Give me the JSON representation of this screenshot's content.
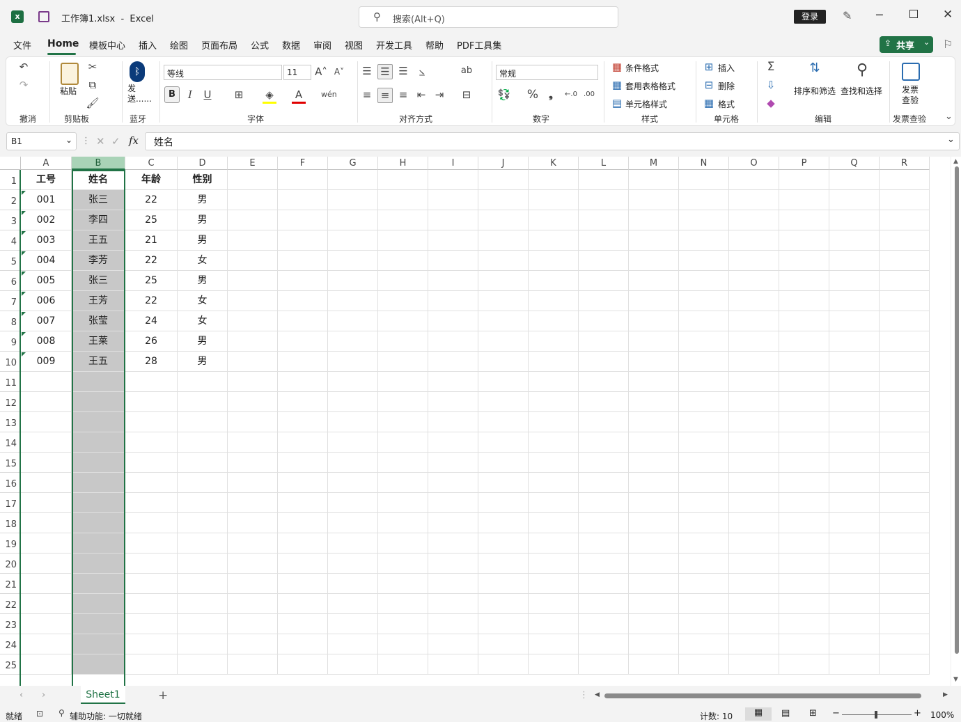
{
  "window": {
    "title": "工作簿1.xlsx  -  Excel",
    "login_label": "登录"
  },
  "search": {
    "placeholder": "搜索(Alt+Q)"
  },
  "menu": {
    "items": [
      "文件",
      "Home",
      "模板中心",
      "插入",
      "绘图",
      "页面布局",
      "公式",
      "数据",
      "审阅",
      "视图",
      "开发工具",
      "帮助",
      "PDF工具集"
    ],
    "active": "Home",
    "share_label": "共享"
  },
  "ribbon": {
    "groups": {
      "undo": "撤消",
      "clipboard": "剪贴板",
      "bluetooth": "蓝牙",
      "font": "字体",
      "align": "对齐方式",
      "number": "数字",
      "styles": "样式",
      "cells": "单元格",
      "edit": "编辑",
      "invoice": "发票查验"
    },
    "paste_label": "粘贴",
    "send_label": "发送......",
    "font_name": "等线",
    "font_size": "11",
    "number_format": "常规",
    "conditional_format": "条件格式",
    "table_format": "套用表格格式",
    "cell_style": "单元格样式",
    "insert": "插入",
    "delete": "删除",
    "format": "格式",
    "sort_filter": "排序和筛选",
    "find_select": "查找和选择",
    "invoice_check": "发票查验",
    "accent": "#217346"
  },
  "formula_bar": {
    "name_box": "B1",
    "fx": "fx",
    "content": "姓名"
  },
  "sheet": {
    "columns": [
      "A",
      "B",
      "C",
      "D",
      "E",
      "F",
      "G",
      "H",
      "I",
      "J",
      "K",
      "L",
      "M",
      "N",
      "O",
      "P",
      "Q",
      "R"
    ],
    "selected_column": "B",
    "rows": [
      [
        "工号",
        "姓名",
        "年龄",
        "性别"
      ],
      [
        "001",
        "张三",
        "22",
        "男"
      ],
      [
        "002",
        "李四",
        "25",
        "男"
      ],
      [
        "003",
        "王五",
        "21",
        "男"
      ],
      [
        "004",
        "李芳",
        "22",
        "女"
      ],
      [
        "005",
        "张三",
        "25",
        "男"
      ],
      [
        "006",
        "王芳",
        "22",
        "女"
      ],
      [
        "007",
        "张莹",
        "24",
        "女"
      ],
      [
        "008",
        "王莱",
        "26",
        "男"
      ],
      [
        "009",
        "王五",
        "28",
        "男"
      ]
    ],
    "row_numbers": [
      "1",
      "2",
      "3",
      "4",
      "5",
      "6",
      "7",
      "8",
      "9",
      "10",
      "11",
      "12",
      "13",
      "14",
      "15",
      "16",
      "17",
      "18",
      "19",
      "20",
      "21",
      "22",
      "23",
      "24",
      "25"
    ]
  },
  "tabs": {
    "sheet_name": "Sheet1",
    "add": "+"
  },
  "status": {
    "ready": "就绪",
    "accessibility": "辅助功能: 一切就绪",
    "count": "计数: 10",
    "zoom": "100%"
  }
}
